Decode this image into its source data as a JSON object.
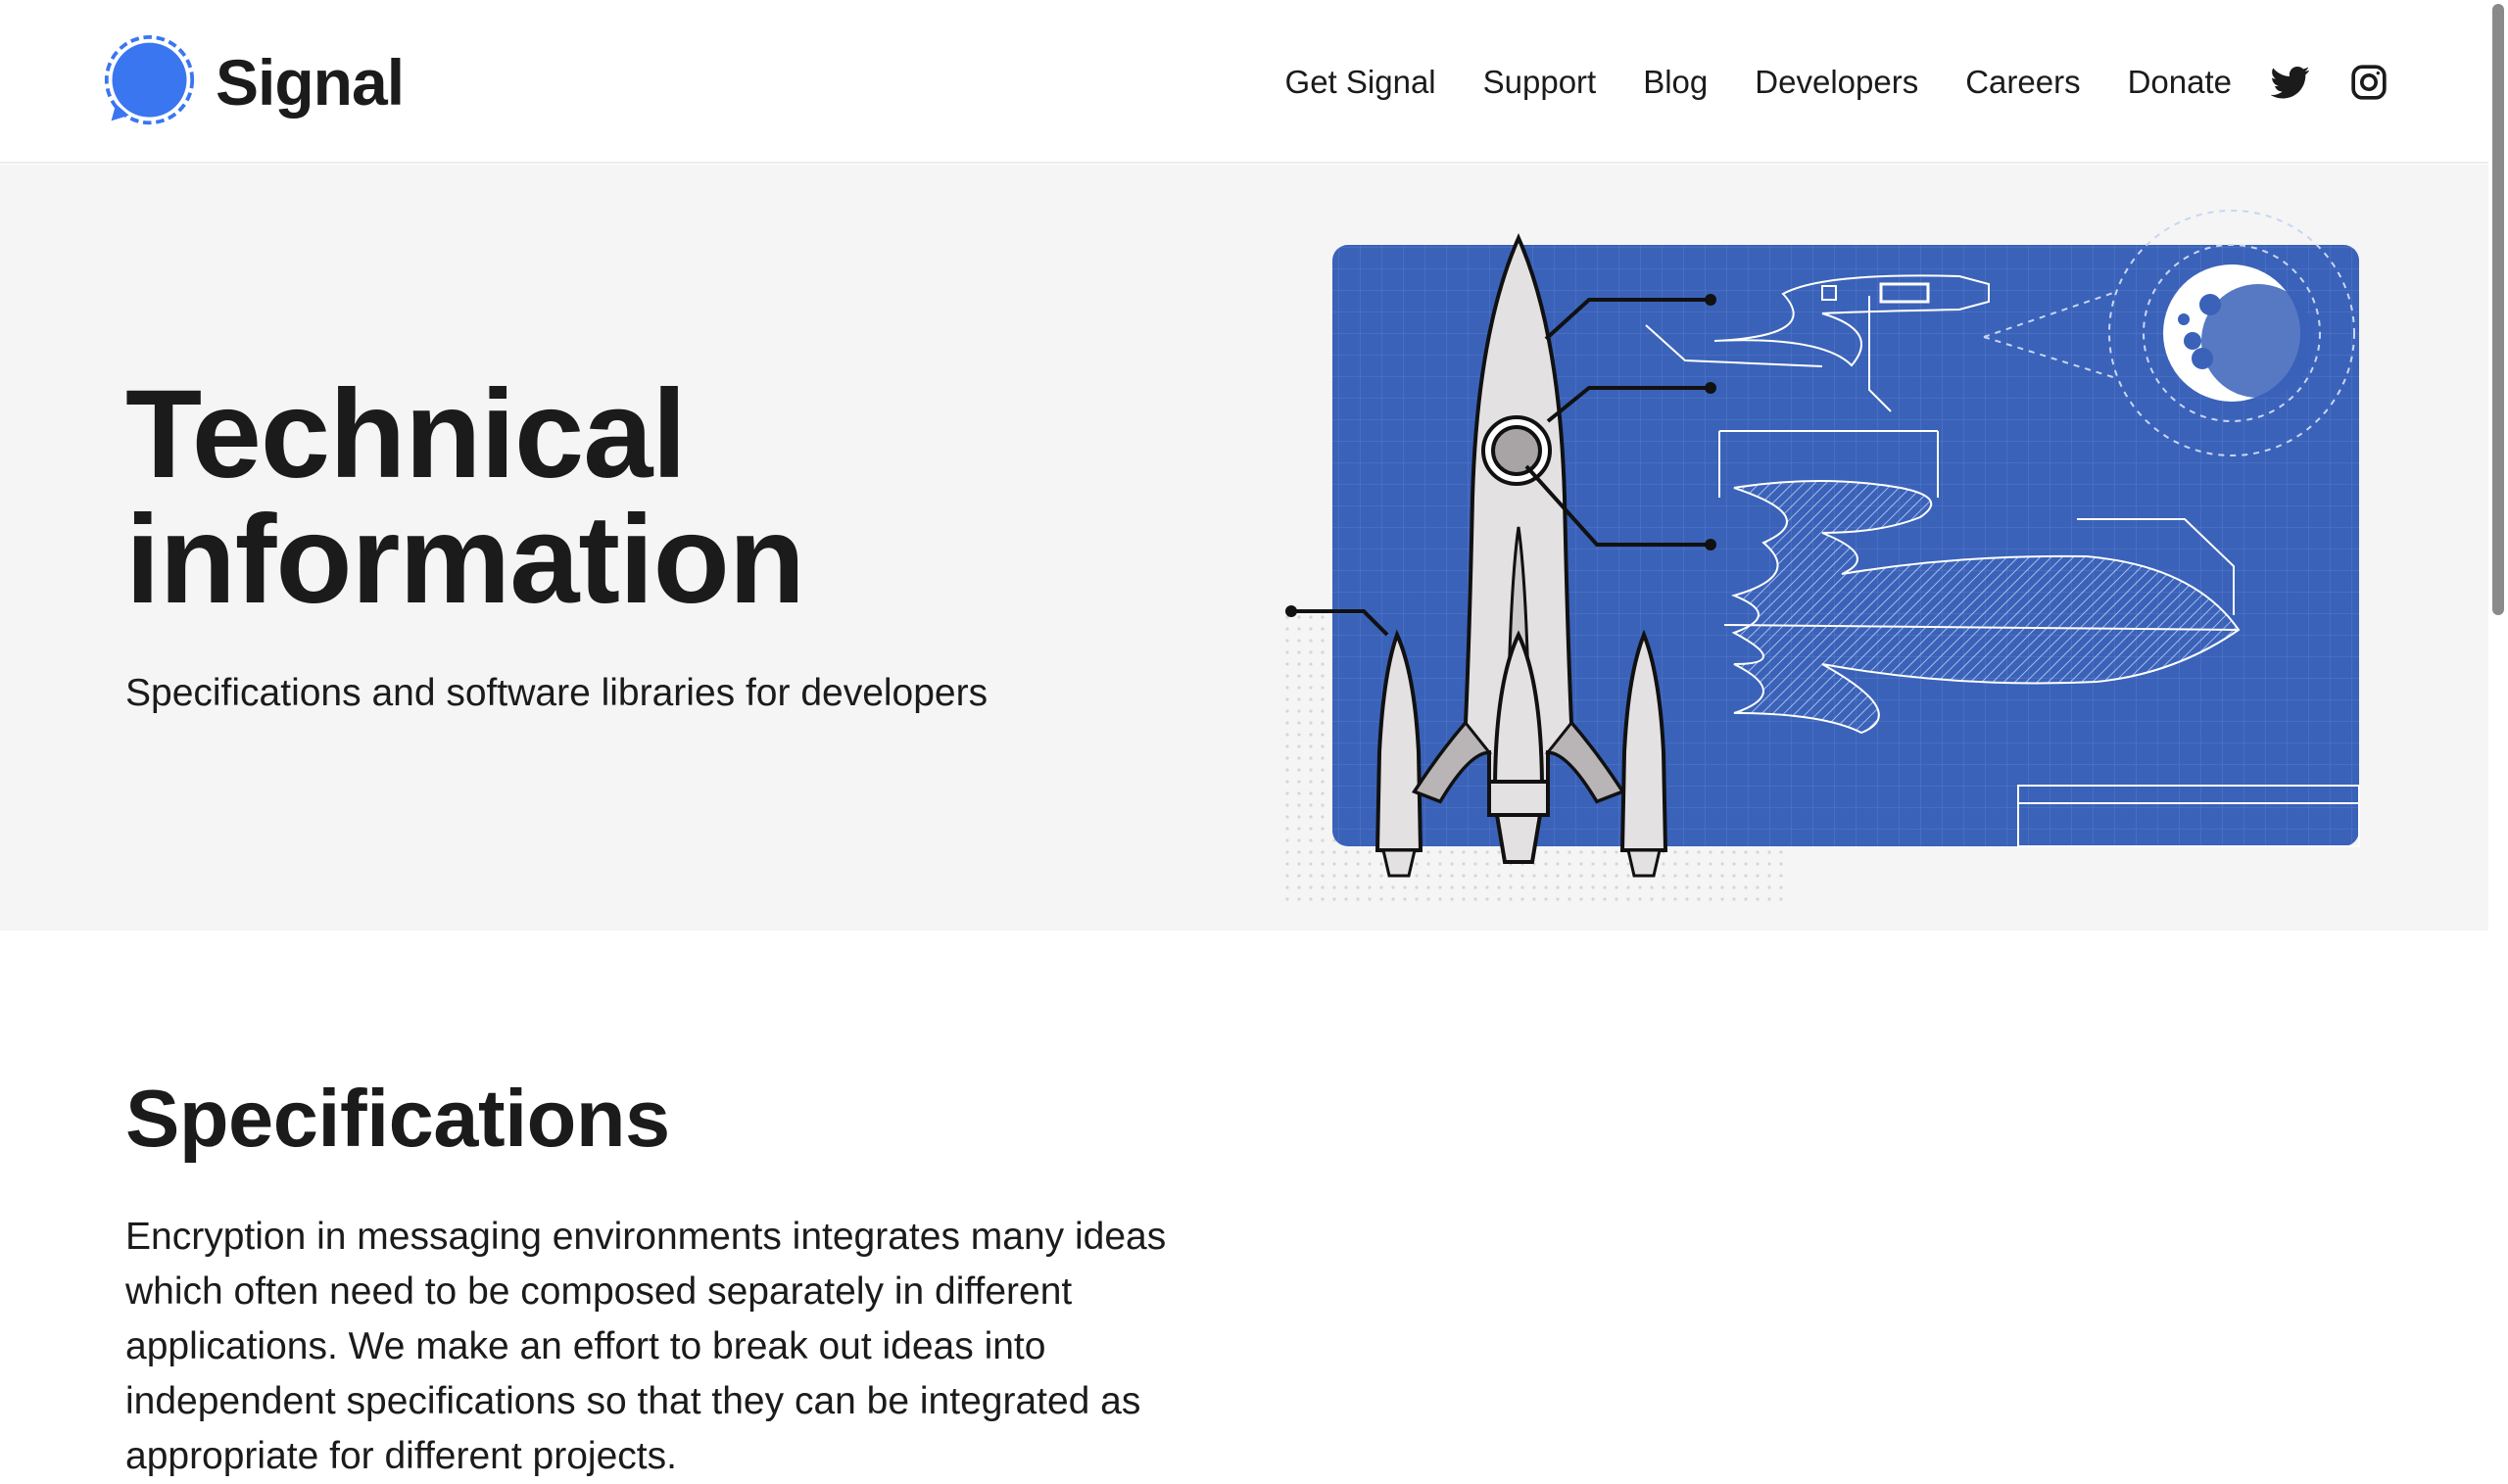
{
  "header": {
    "brand": "Signal",
    "nav": [
      {
        "label": "Get Signal"
      },
      {
        "label": "Support"
      },
      {
        "label": "Blog"
      },
      {
        "label": "Developers"
      },
      {
        "label": "Careers"
      },
      {
        "label": "Donate"
      }
    ],
    "social_icons": [
      "twitter-icon",
      "instagram-icon"
    ]
  },
  "hero": {
    "title": "Technical information",
    "subtitle": "Specifications and software libraries for developers"
  },
  "specifications": {
    "heading": "Specifications",
    "body": "Encryption in messaging environments integrates many ideas which often need to be composed separately in different applications. We make an effort to break out ideas into independent specifications so that they can be integrated as appropriate for different projects."
  },
  "colors": {
    "brand_blue": "#3a76f0",
    "blueprint": "#3a62b9",
    "hero_bg": "#f5f5f5",
    "text": "#1b1b1b"
  }
}
